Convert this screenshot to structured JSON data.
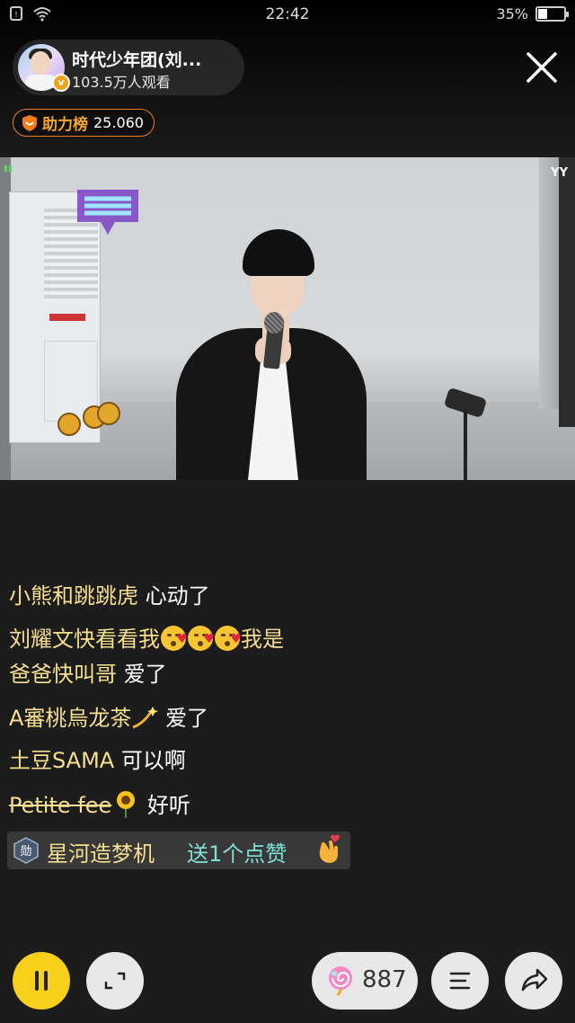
{
  "status_bar": {
    "time": "22:42",
    "battery": "35%",
    "battery_level": 0.35
  },
  "streamer": {
    "name": "时代少年团(刘...",
    "viewers": "103.5万人观看",
    "verified_icon": "v-badge-icon"
  },
  "support_rank": {
    "label": "助力榜",
    "value": "25.060"
  },
  "video": {
    "watermark": "YY"
  },
  "chat": {
    "lines": [
      {
        "user": "小熊和跳跳虎",
        "message": "心动了"
      },
      {
        "user": "刘耀文快看看我",
        "message": "我是"
      },
      {
        "user": "爸爸快叫哥",
        "message": "爱了"
      },
      {
        "user": "A審桃烏龙茶",
        "message": "爱了"
      },
      {
        "user": "土豆SAMA",
        "message": "可以啊"
      },
      {
        "user": "Petite fee",
        "message": "好听"
      }
    ],
    "gift": {
      "badge": "勋",
      "user": "星河造梦机",
      "action": "送1个点赞"
    }
  },
  "controls": {
    "gift_count": "887"
  },
  "colors": {
    "accent": "#f8cf1a",
    "username": "#f6df8f",
    "gift_action": "#7fe0d6",
    "rank_border": "#f07d1a"
  }
}
